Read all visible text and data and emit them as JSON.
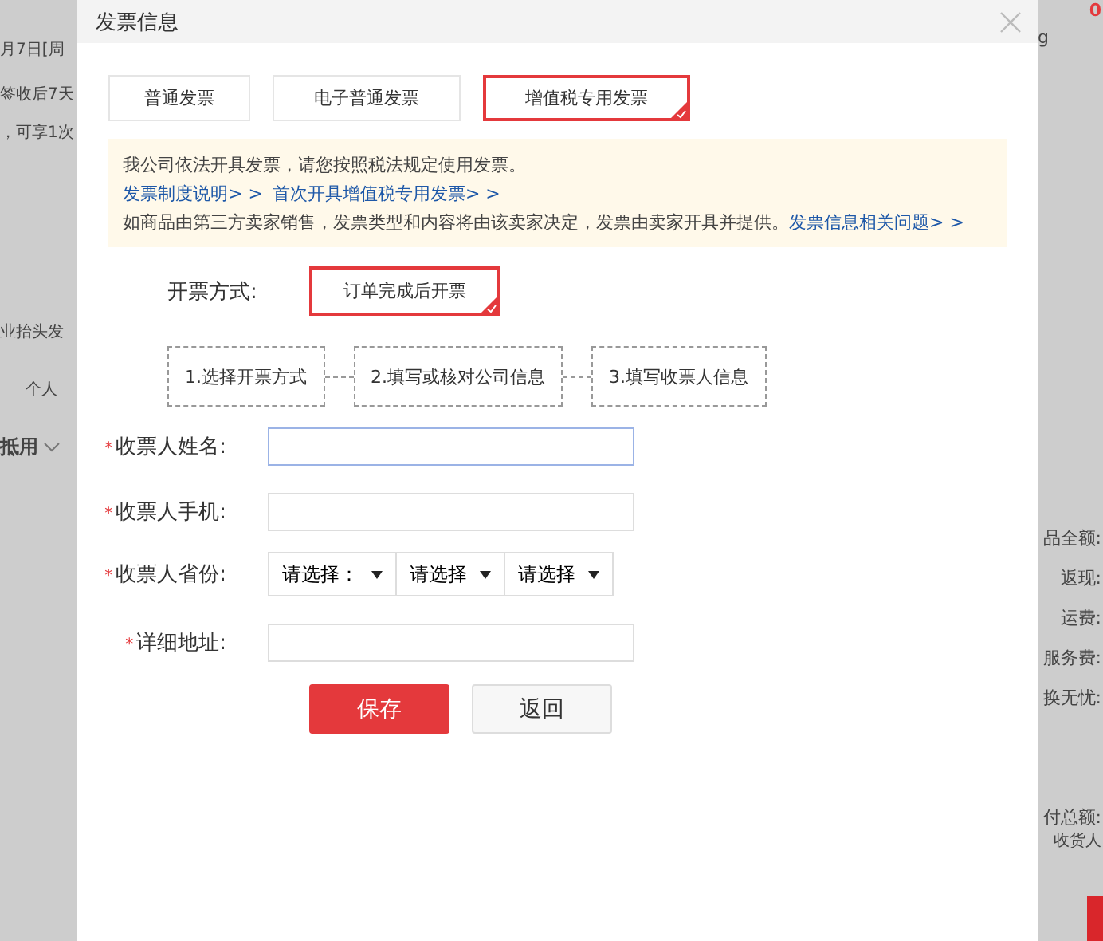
{
  "background_left": [
    {
      "text": "月7日[周"
    },
    {
      "text": "签收后7天"
    },
    {
      "text": "，可享1次"
    },
    {
      "text": "业抬头发"
    },
    {
      "text": "个人"
    },
    {
      "text": "抵用"
    }
  ],
  "background_right": [
    {
      "kind": "alert",
      "text": "0"
    },
    {
      "kind": "note",
      "text": "g"
    },
    {
      "kind": "label",
      "text": "品全额:"
    },
    {
      "kind": "label",
      "text": "返现:"
    },
    {
      "kind": "label",
      "text": "运费:"
    },
    {
      "kind": "label",
      "text": "服务费:"
    },
    {
      "kind": "label",
      "text": "换无忧:"
    },
    {
      "kind": "label",
      "text": "付总额:"
    },
    {
      "kind": "note",
      "text": "收货人"
    }
  ],
  "window": {
    "title": "发票信息"
  },
  "invoice_types": [
    {
      "label": "普通发票",
      "selected": false
    },
    {
      "label": "电子普通发票",
      "selected": false
    },
    {
      "label": "增值税专用发票",
      "selected": true
    }
  ],
  "notice": {
    "line_1": "我公司依法开具发票，请您按照税法规定使用发票。",
    "links": [
      "发票制度说明> >",
      "首次开具增值税专用发票> >"
    ],
    "line_3": "如商品由第三方卖家销售，发票类型和内容将由该卖家决定，发票由卖家开具并提供。",
    "line_3_link": "发票信息相关问题> >"
  },
  "issue_method": {
    "label": "开票方式:",
    "options": [
      {
        "label": "订单完成后开票",
        "selected": true
      }
    ]
  },
  "steps": [
    "1.选择开票方式",
    "2.填写或核对公司信息",
    "3.填写收票人信息"
  ],
  "fields": [
    {
      "kind": "text",
      "required_mark": "*",
      "label": "收票人姓名:",
      "focused": true
    },
    {
      "kind": "text",
      "required_mark": "*",
      "label": "收票人手机:",
      "focused": false
    },
    {
      "kind": "select",
      "required_mark": "*",
      "label": "收票人省份:",
      "options": [
        "请选择：",
        "请选择",
        "请选择"
      ]
    },
    {
      "kind": "text",
      "required_mark": "*",
      "label": "详细地址:",
      "focused": false
    }
  ],
  "buttons": [
    {
      "kind": "primary",
      "label": "保存"
    },
    {
      "kind": "secondary",
      "label": "返回"
    }
  ]
}
